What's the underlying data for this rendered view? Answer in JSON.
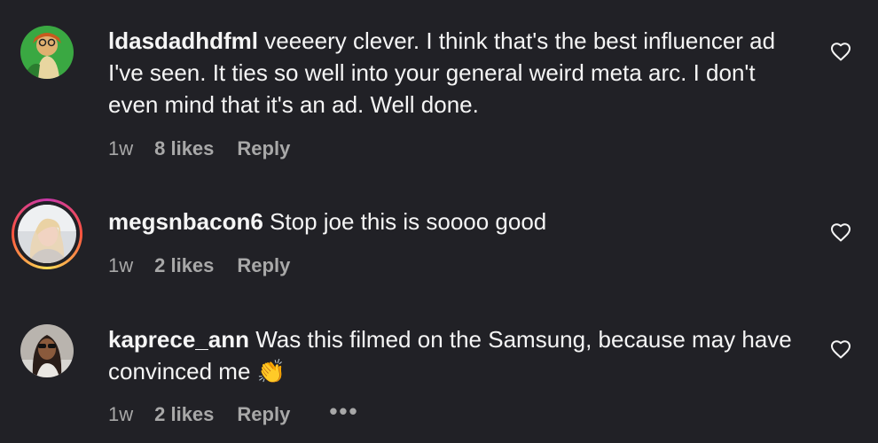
{
  "comments": [
    {
      "username": "ldasdadhdfml",
      "text": " veeeery clever. I think that's the best influencer ad I've seen. It ties so well into your general weird meta arc. I don't even mind that it's an ad. Well done.",
      "time": "1w",
      "likes": "8 likes",
      "reply": "Reply"
    },
    {
      "username": "megsnbacon6",
      "text": " Stop joe this is soooo good",
      "time": "1w",
      "likes": "2 likes",
      "reply": "Reply"
    },
    {
      "username": "kaprece_ann",
      "text": " Was this filmed on the Samsung, because may have convinced me 👏",
      "time": "1w",
      "likes": "2 likes",
      "reply": "Reply",
      "more": "•••"
    }
  ],
  "icons": {
    "like": "heart-outline-icon",
    "more": "ellipsis-icon"
  },
  "colors": {
    "background": "#212126",
    "text": "#f5f5f5",
    "muted": "#a8a8a8"
  }
}
